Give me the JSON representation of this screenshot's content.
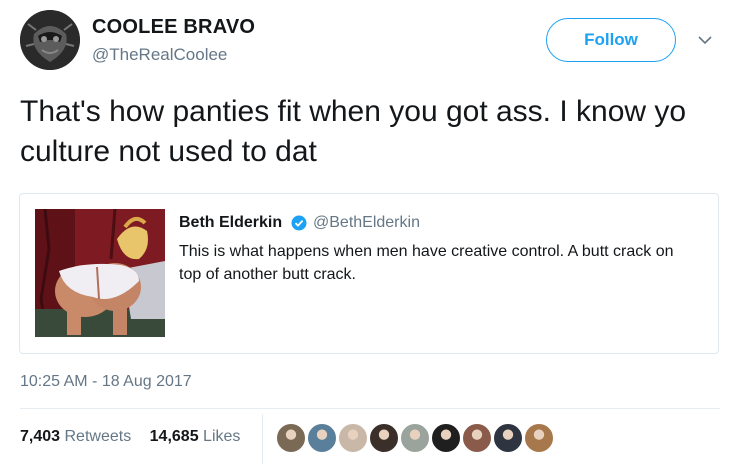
{
  "author": {
    "name": "COOLEE BRAVO",
    "handle": "@TheRealCoolee",
    "avatar_icon": "masked-face-avatar"
  },
  "follow_button": {
    "label": "Follow",
    "color": "#1da1f2"
  },
  "more_menu_icon": "chevron-down-icon",
  "tweet": {
    "text": "That's how panties fit when you got ass. I know yo culture not used to dat"
  },
  "quoted_tweet": {
    "name": "Beth Elderkin",
    "verified": true,
    "handle": "@BethElderkin",
    "text": "This is what happens when men have creative control. A butt crack on top of another butt crack.",
    "image_icon": "cartoon-image-thumbnail"
  },
  "timestamp": "10:25 AM - 18 Aug 2017",
  "stats": {
    "retweets_count": "7,403",
    "retweets_label": "Retweets",
    "likes_count": "14,685",
    "likes_label": "Likes"
  },
  "likers": [
    {
      "icon": "liker-avatar-1",
      "color": "#7a6a55"
    },
    {
      "icon": "liker-avatar-2",
      "color": "#5a7f9a"
    },
    {
      "icon": "liker-avatar-3",
      "color": "#c9b7a8"
    },
    {
      "icon": "liker-avatar-4",
      "color": "#3b2f2a"
    },
    {
      "icon": "liker-avatar-5",
      "color": "#9aa39c"
    },
    {
      "icon": "liker-avatar-6",
      "color": "#1f1f1f"
    },
    {
      "icon": "liker-avatar-7",
      "color": "#8a5a4a"
    },
    {
      "icon": "liker-avatar-8",
      "color": "#2e3440"
    },
    {
      "icon": "liker-avatar-9",
      "color": "#a7784b"
    }
  ],
  "colors": {
    "accent": "#1da1f2",
    "secondary_text": "#657786",
    "primary_text": "#14171a",
    "border": "#e1e8ed"
  }
}
